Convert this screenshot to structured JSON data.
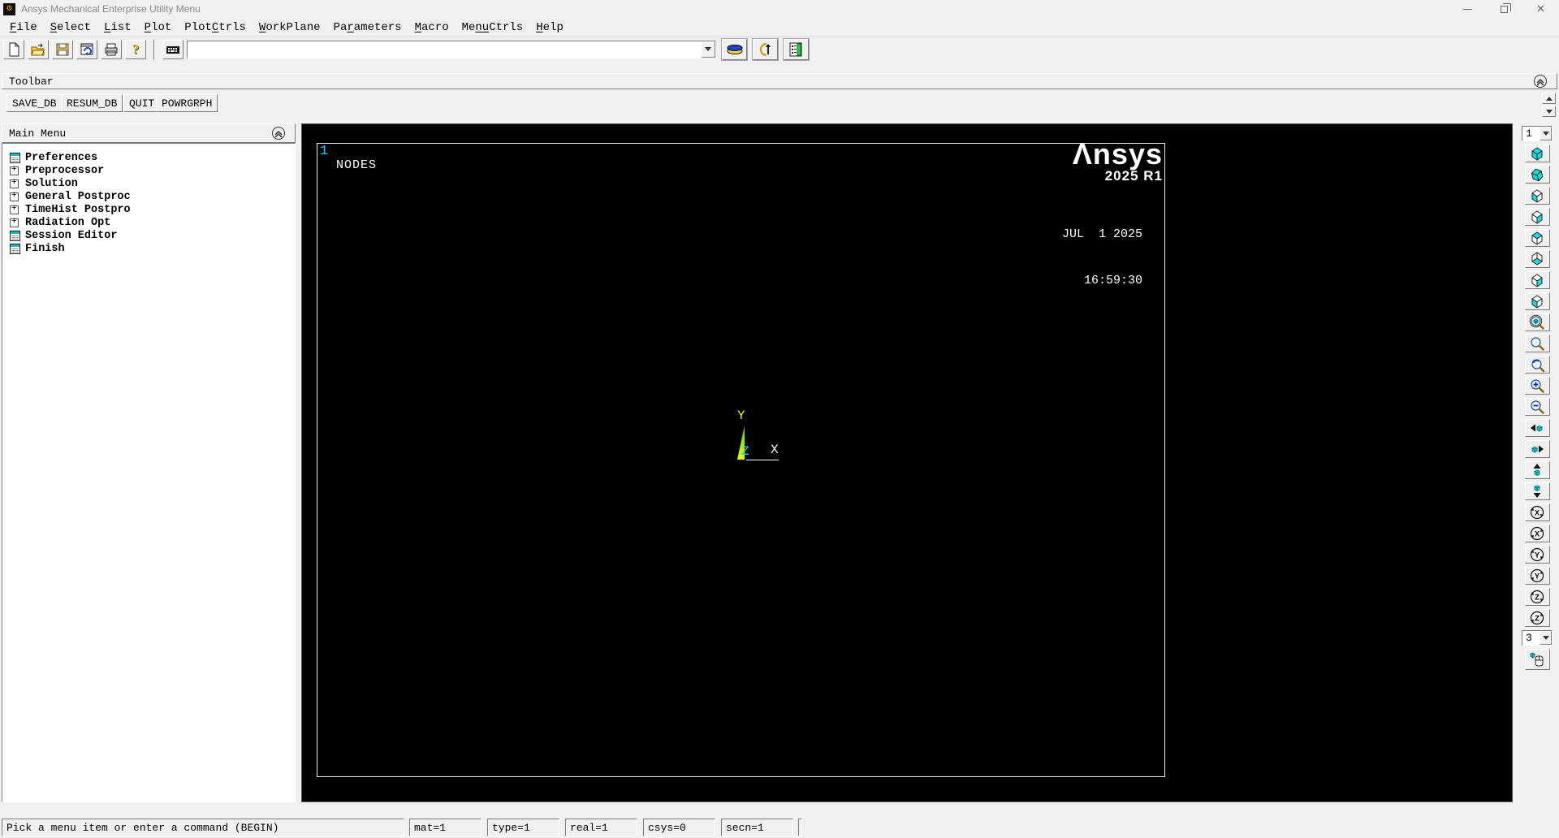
{
  "window": {
    "title": "Ansys Mechanical Enterprise Utility Menu",
    "controls": {
      "minimize": "minimize",
      "restore": "restore",
      "close": "close"
    }
  },
  "menu_bar": {
    "items": [
      {
        "pre": "",
        "accel": "F",
        "post": "ile"
      },
      {
        "pre": "",
        "accel": "S",
        "post": "elect"
      },
      {
        "pre": "",
        "accel": "L",
        "post": "ist"
      },
      {
        "pre": "",
        "accel": "P",
        "post": "lot"
      },
      {
        "pre": "Plot",
        "accel": "C",
        "post": "trls"
      },
      {
        "pre": "",
        "accel": "W",
        "post": "orkPlane"
      },
      {
        "pre": "Pa",
        "accel": "r",
        "post": "ameters"
      },
      {
        "pre": "",
        "accel": "M",
        "post": "acro"
      },
      {
        "pre": "Me",
        "accel": "nu",
        "post": "Ctrls"
      },
      {
        "pre": "",
        "accel": "H",
        "post": "elp"
      }
    ]
  },
  "utility_toolbar": {
    "command_value": "",
    "help_glyph": "?"
  },
  "toolbar_panel": {
    "title": "Toolbar",
    "buttons": [
      "SAVE_DB",
      "RESUM_DB",
      "QUIT",
      "POWRGRPH"
    ]
  },
  "main_menu": {
    "title": "Main Menu",
    "items": [
      {
        "label": "Preferences",
        "type": "dialog"
      },
      {
        "label": "Preprocessor",
        "type": "expand"
      },
      {
        "label": "Solution",
        "type": "expand"
      },
      {
        "label": "General Postproc",
        "type": "expand"
      },
      {
        "label": "TimeHist Postpro",
        "type": "expand"
      },
      {
        "label": "Radiation Opt",
        "type": "expand"
      },
      {
        "label": "Session Editor",
        "type": "dialog"
      },
      {
        "label": "Finish",
        "type": "dialog"
      }
    ]
  },
  "graphics": {
    "window_number": "1",
    "plot_label": "NODES",
    "brand": "Ansys",
    "brand_display": "Λnsys",
    "version": "2025 R1",
    "date": "JUL  1 2025",
    "time": "16:59:30",
    "triad": {
      "x_label": "X",
      "y_label": "Y",
      "z_label": "Z"
    }
  },
  "right_toolbar": {
    "window_combo_value": "1",
    "rate_combo_value": "3",
    "rot_labels": [
      "X",
      "X",
      "Y",
      "Y",
      "Z",
      "Z"
    ]
  },
  "status_bar": {
    "prompt": "Pick a menu item or enter a command (BEGIN)",
    "fields": [
      "mat=1",
      "type=1",
      "real=1",
      "csys=0",
      "secn=1"
    ]
  },
  "colors": {
    "graphics_bg": "#000000",
    "cyan": "#00d8ff",
    "triad_yellow_green": "#d6ff20",
    "ui_bg": "#f0f0f0",
    "cube_icon_cyan": "#17dede"
  },
  "icons": {
    "app-icon": "black square with orange gears",
    "new-file-icon": "blank page",
    "open-folder-icon": "opening folder",
    "save-icon": "floppy disk",
    "replot-icon": "window with blue refresh arrow",
    "print-icon": "printer",
    "help-icon": "yellow question mark",
    "keyboard-icon": "keyboard",
    "raise-hidden-icon": "stacked windows",
    "reset-picking-icon": "crescent with up arrow",
    "contact-manager-icon": "window with green bar",
    "collapse-icon": "circled double chevron up",
    "view-cube-icon": "cyan cube",
    "magnifier-icon": "magnifying glass",
    "pan-arrow-icon": "cube with arrow",
    "rotate-icon": "circle with axis letter",
    "mouse-icon": "mouse with cube"
  }
}
